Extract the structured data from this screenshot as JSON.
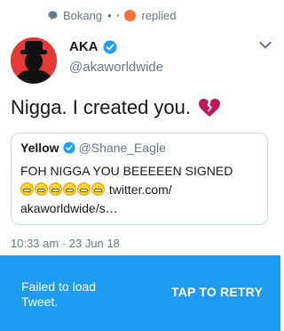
{
  "context": {
    "user": "Bokang",
    "separator": "•",
    "small_separator": "•",
    "action": "replied",
    "bubble_icon": "chat-bubble-icon"
  },
  "tweet": {
    "display_name": "AKA",
    "handle": "@akaworldwide",
    "text": "Nigga. I created you.",
    "emoji": "broken-heart-icon",
    "timestamp": "10:33 am · 23 Jun 18"
  },
  "quote": {
    "display_name": "Yellow",
    "handle": "@Shane_Eagle",
    "text_main": "FOH NIGGA YOU BEEEEEN SIGNED",
    "emoji_count": 6,
    "link_text_1": "twitter.com/",
    "link_text_2": "akaworldwide/s…"
  },
  "error": {
    "message": "Failed to load Tweet.",
    "retry_label": "TAP TO RETRY"
  },
  "colors": {
    "accent": "#1d9bf0",
    "verified": "#1da1f2",
    "muted": "#657786",
    "border": "#ccd6dd",
    "avatar_bg": "#e53935",
    "heart": "#c2185b"
  }
}
